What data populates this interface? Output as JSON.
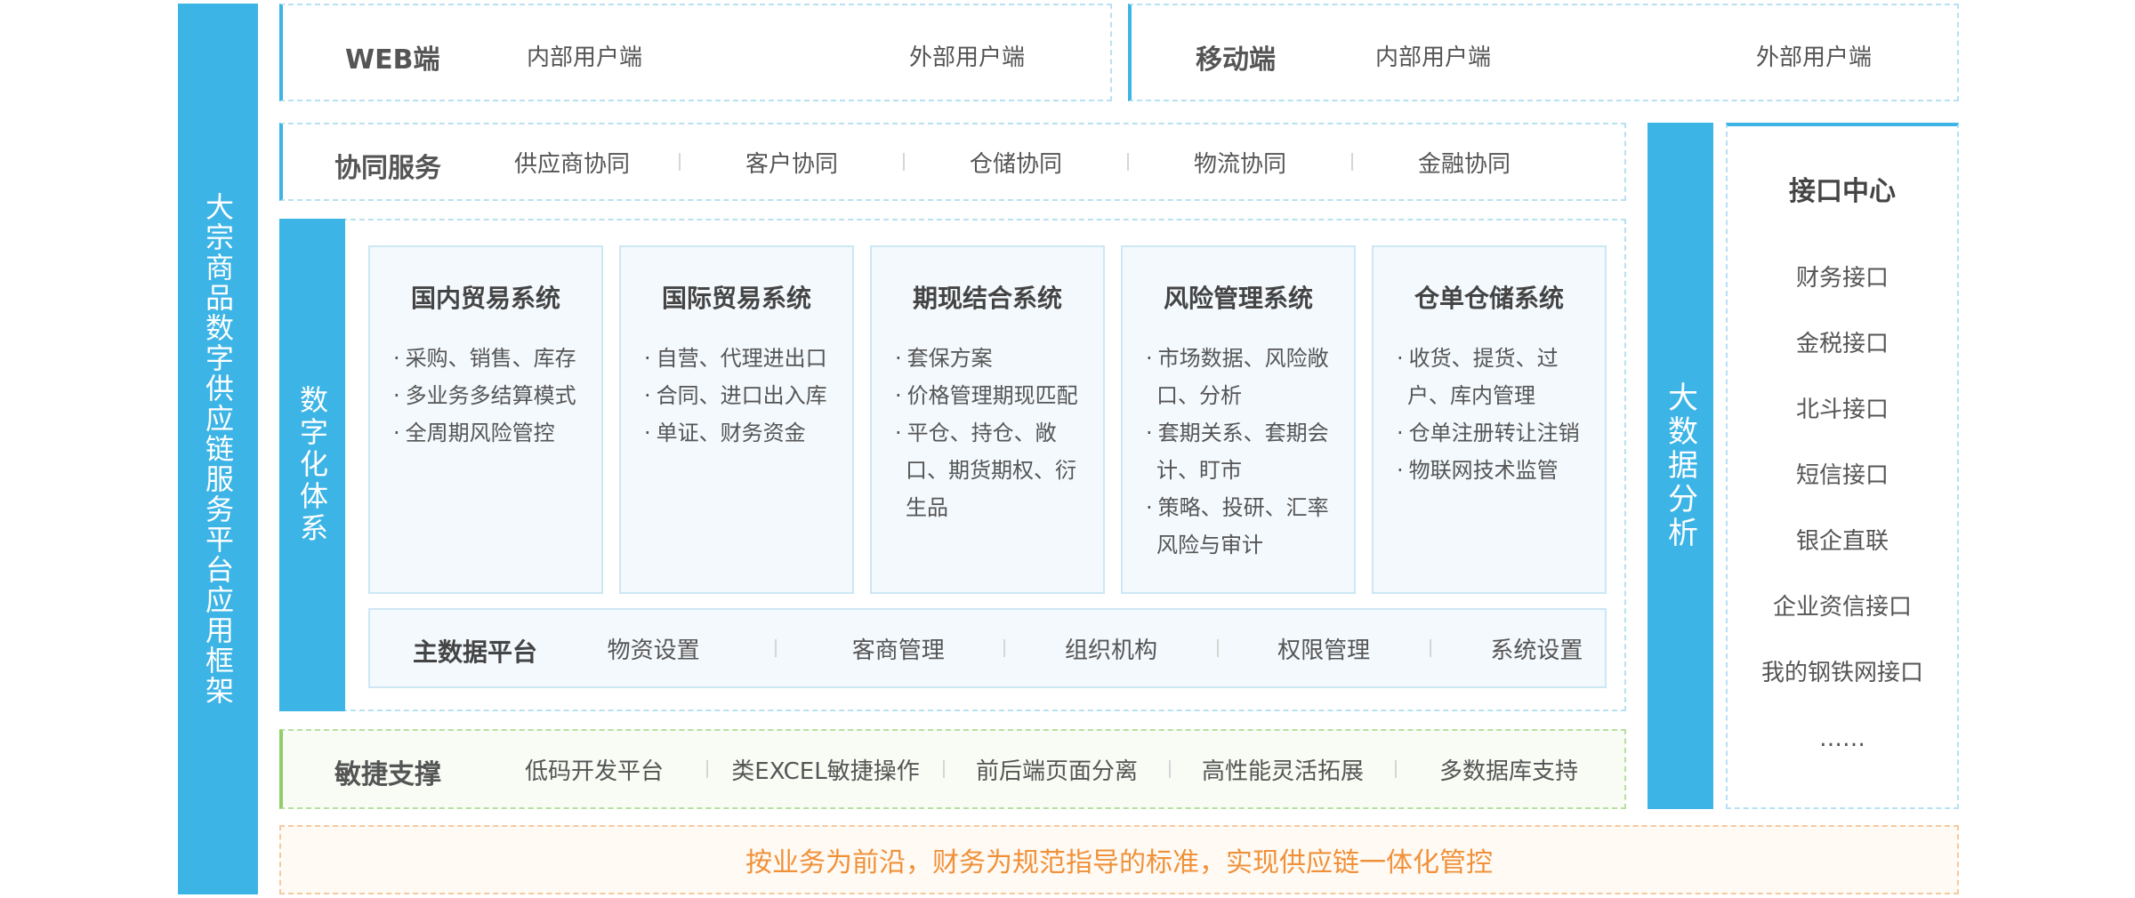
{
  "left_title": "大宗商品数字供应链服务平台应用框架",
  "web": {
    "title": "WEB端",
    "internal": "内部用户端",
    "external": "外部用户端"
  },
  "mobile": {
    "title": "移动端",
    "internal": "内部用户端",
    "external": "外部用户端"
  },
  "collab": {
    "title": "协同服务",
    "items": [
      "供应商协同",
      "客户协同",
      "仓储协同",
      "物流协同",
      "金融协同"
    ]
  },
  "digital": {
    "title": "数字化体系",
    "systems": [
      {
        "title": "国内贸易系统",
        "items": [
          "采购、销售、库存",
          "多业务多结算模式",
          "全周期风险管控"
        ]
      },
      {
        "title": "国际贸易系统",
        "items": [
          "自营、代理进出口",
          "合同、进口出入库",
          "单证、财务资金"
        ]
      },
      {
        "title": "期现结合系统",
        "items": [
          "套保方案",
          "价格管理期现匹配",
          "平仓、持仓、敞口、期货期权、衍生品"
        ]
      },
      {
        "title": "风险管理系统",
        "items": [
          "市场数据、风险敞口、分析",
          "套期关系、套期会计、盯市",
          "策略、投研、汇率风险与审计"
        ]
      },
      {
        "title": "仓单仓储系统",
        "items": [
          "收货、提货、过户、库内管理",
          "仓单注册转让注销",
          "物联网技术监管"
        ]
      }
    ],
    "master": {
      "title": "主数据平台",
      "items": [
        "物资设置",
        "客商管理",
        "组织机构",
        "权限管理",
        "系统设置"
      ]
    }
  },
  "agile": {
    "title": "敏捷支撑",
    "items": [
      "低码开发平台",
      "类EXCEL敏捷操作",
      "前后端页面分离",
      "高性能灵活拓展",
      "多数据库支持"
    ]
  },
  "bigdata": {
    "title": "大数据分析"
  },
  "interface": {
    "title": "接口中心",
    "items": [
      "财务接口",
      "金税接口",
      "北斗接口",
      "短信接口",
      "银企直联",
      "企业资信接口",
      "我的钢铁网接口",
      "……"
    ]
  },
  "slogan": "按业务为前沿，财务为规范指导的标准，实现供应链一体化管控",
  "colors": {
    "accent": "#3db4e6",
    "green": "#8fcf6a",
    "orange": "#f0913a"
  }
}
